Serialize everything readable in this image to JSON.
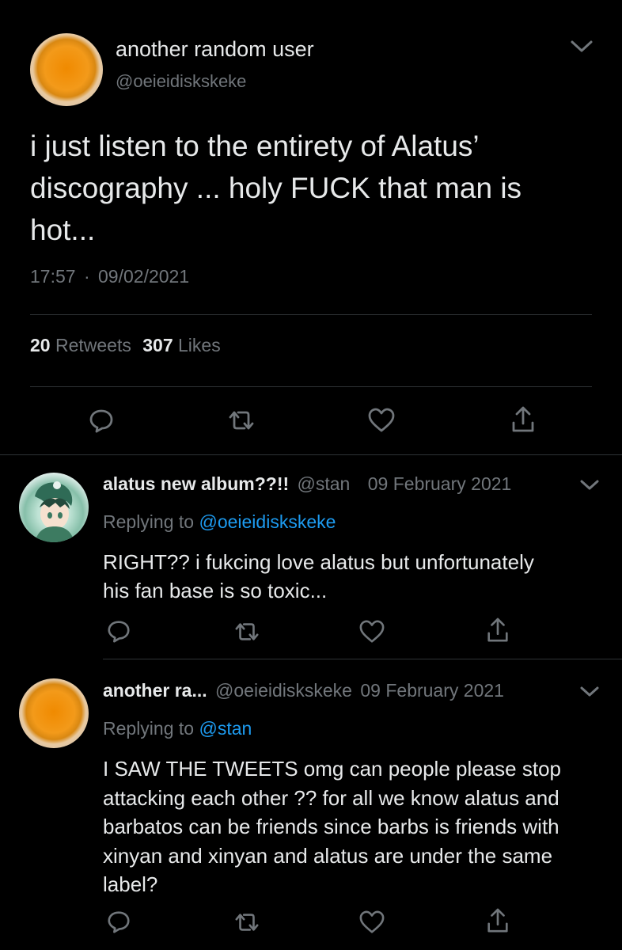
{
  "main_tweet": {
    "display_name": "another random user",
    "handle": "@oeieidiskskeke",
    "text": "i just listen to the entirety of Alatus’ discography ... holy FUCK that man is hot...",
    "time": "17:57",
    "separator": "·",
    "date": "09/02/2021",
    "retweets_count": "20",
    "retweets_label": "Retweets",
    "likes_count": "307",
    "likes_label": "Likes"
  },
  "replies": [
    {
      "display_name": "alatus new album??!!",
      "handle": "@stan",
      "date": "09 February 2021",
      "replying_prefix": "Replying to",
      "replying_to": "@oeieidiskskeke",
      "text": "RIGHT?? i fukcing love alatus but unfortunately his fan base is so toxic..."
    },
    {
      "display_name": "another ra...",
      "handle": "@oeieidiskskeke",
      "date": "09 February 2021",
      "replying_prefix": "Replying to",
      "replying_to": "@stan",
      "text": "I SAW THE TWEETS omg can people please stop attacking each other ?? for all we know alatus and barbatos can be friends since barbs is friends with xinyan and xinyan and alatus are under the same label?"
    }
  ],
  "icons": {
    "menu": "chevron-down-icon",
    "reply": "reply-icon",
    "retweet": "retweet-icon",
    "like": "heart-icon",
    "share": "share-icon"
  },
  "colors": {
    "background": "#000000",
    "text": "#e7e9ea",
    "muted": "#71767b",
    "link": "#1d9bf0",
    "divider": "#2f3336"
  }
}
